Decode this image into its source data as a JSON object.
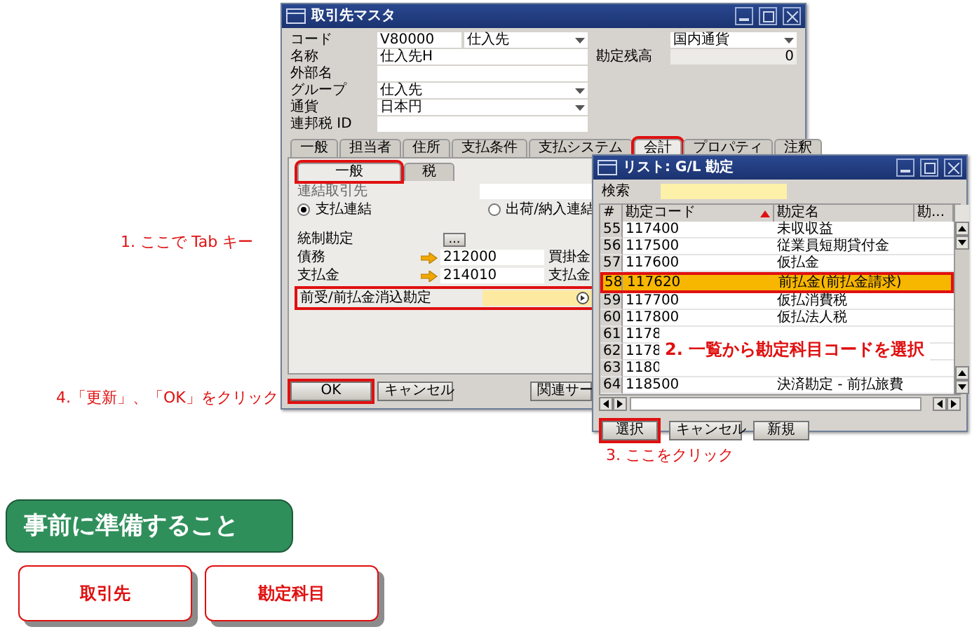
{
  "main_window": {
    "title": "取引先マスタ",
    "fields": [
      {
        "label": "コード",
        "value": "V80000",
        "kind": "text"
      },
      {
        "label": "名称",
        "value": "仕入先H",
        "kind": "text"
      },
      {
        "label": "外部名",
        "kind": "text"
      },
      {
        "label": "グループ",
        "value": "仕入先",
        "kind": "dropdown"
      },
      {
        "label": "通貨",
        "value": "日本円",
        "kind": "dropdown"
      },
      {
        "label": "連邦税 ID",
        "kind": "text"
      }
    ],
    "type_dropdown": {
      "value": "仕入先"
    },
    "currency_dropdown": {
      "value": "国内通貨"
    },
    "balance": {
      "label": "勘定残高",
      "value": "0"
    },
    "tabs": [
      {
        "label": "一般",
        "selected": false,
        "highlighted": false
      },
      {
        "label": "担当者",
        "selected": false,
        "highlighted": false
      },
      {
        "label": "住所",
        "selected": false,
        "highlighted": false
      },
      {
        "label": "支払条件",
        "selected": false,
        "highlighted": false
      },
      {
        "label": "支払システム",
        "selected": false,
        "highlighted": false
      },
      {
        "label": "会計",
        "selected": true,
        "highlighted": true
      },
      {
        "label": "プロパティ",
        "selected": false,
        "highlighted": false
      },
      {
        "label": "注釈",
        "selected": false,
        "highlighted": false
      }
    ],
    "subtabs": [
      {
        "label": "一般",
        "selected": true,
        "highlighted": true
      },
      {
        "label": "税",
        "selected": false,
        "highlighted": false
      }
    ],
    "linked_partner": {
      "label": "連結取引先"
    },
    "link_options": [
      {
        "label": "支払連結",
        "selected": true
      },
      {
        "label": "出荷/納入連結",
        "selected": false
      }
    ],
    "control_accounts": {
      "label": "統制勘定",
      "button": "..."
    },
    "accounts": [
      {
        "label": "債務",
        "value": "212000",
        "side_label": "買掛金"
      },
      {
        "label": "支払金",
        "value": "214010",
        "side_label": "支払金"
      }
    ],
    "clearing_account": {
      "label": "前受/前払金消込勘定",
      "highlighted": true
    },
    "buttons": [
      {
        "label": "OK",
        "highlighted": true
      },
      {
        "label": "キャンセル",
        "highlighted": false
      },
      {
        "label": "関連サー",
        "highlighted": false
      }
    ]
  },
  "list_window": {
    "title": "リスト: G/L 勘定",
    "search": {
      "label": "検索"
    },
    "columns": [
      {
        "label": "#",
        "sorted": false
      },
      {
        "label": "勘定コード",
        "sorted": true
      },
      {
        "label": "勘定名",
        "sorted": false
      },
      {
        "label": "勘...",
        "sorted": false
      }
    ],
    "rows": [
      {
        "num": "55",
        "code": "117400",
        "name": "未収収益",
        "selected": false
      },
      {
        "num": "56",
        "code": "117500",
        "name": "従業員短期貸付金",
        "selected": false
      },
      {
        "num": "57",
        "code": "117600",
        "name": "仮払金",
        "selected": false
      },
      {
        "num": "58",
        "code": "117620",
        "name": "前払金(前払金請求)",
        "selected": true
      },
      {
        "num": "59",
        "code": "117700",
        "name": "仮払消費税",
        "selected": false
      },
      {
        "num": "60",
        "code": "117800",
        "name": "仮払法人税",
        "selected": false
      },
      {
        "num": "61",
        "code": "1178",
        "selected": false
      },
      {
        "num": "62",
        "code": "1178",
        "selected": false
      },
      {
        "num": "63",
        "code": "1180",
        "selected": false
      },
      {
        "num": "64",
        "code": "118500",
        "name": "決済勘定 - 前払旅費",
        "selected": false
      }
    ],
    "buttons": [
      {
        "label": "選択",
        "highlighted": true
      },
      {
        "label": "キャンセル",
        "highlighted": false
      },
      {
        "label": "新規",
        "highlighted": false
      }
    ]
  },
  "annotations": [
    {
      "text": "1. ここで Tab キー"
    },
    {
      "text": "2. 一覧から勘定科目コードを選択"
    },
    {
      "text": "3. ここをクリック"
    },
    {
      "text": "4.「更新」、「OK」をクリック"
    }
  ],
  "section": {
    "heading": "事前に準備すること",
    "items": [
      "取引先",
      "勘定科目"
    ]
  }
}
